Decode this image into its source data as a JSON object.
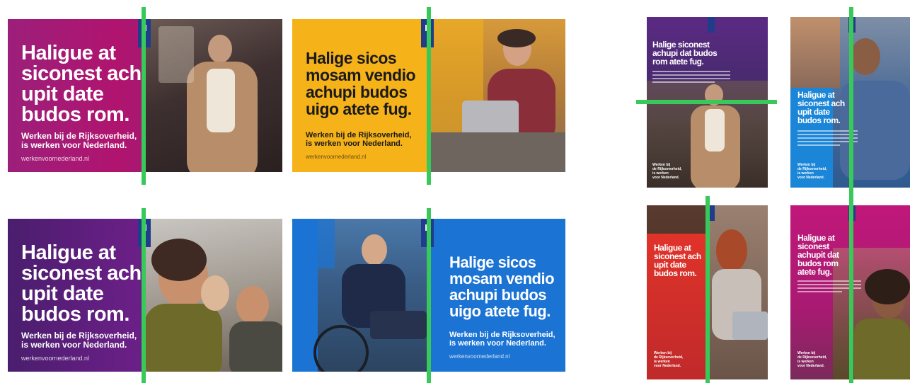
{
  "accent_color": "#38c95a",
  "cards": {
    "c1": {
      "headline": [
        "Haligue at",
        "siconest ach",
        "upit date",
        "budos rom."
      ],
      "sub": [
        "Werken bij de Rijksoverheid,",
        "is werken voor Nederland."
      ],
      "url": "werkenvoornederland.nl",
      "color": "#9c1f7a"
    },
    "c2": {
      "headline": [
        "Halige sicos",
        "mosam vendio",
        "achupi budos",
        "uigo atete fug."
      ],
      "sub": [
        "Werken bij de Rijksoverheid,",
        "is werken voor Nederland."
      ],
      "url": "werkenvoornederland.nl",
      "color": "#f6b219"
    },
    "c3": {
      "headline": [
        "Haligue at",
        "siconest ach",
        "upit date",
        "budos rom."
      ],
      "sub": [
        "Werken bij de Rijksoverheid,",
        "is werken voor Nederland."
      ],
      "url": "werkenvoornederland.nl",
      "color": "#6a1f86"
    },
    "c4": {
      "headline": [
        "Halige sicos",
        "mosam vendio",
        "achupi budos",
        "uigo atete fug."
      ],
      "sub": [
        "Werken bij de Rijksoverheid,",
        "is werken voor Nederland."
      ],
      "url": "werkenvoornederland.nl",
      "color": "#1b73d4"
    },
    "p1": {
      "headline": [
        "Halige siconest",
        "achupi dat budos",
        "rom atete fug."
      ],
      "sub": [
        "Werken bij",
        "de Rijksoverheid,",
        "is werken",
        "voor Nederland."
      ],
      "color": "#5b2a84"
    },
    "p2": {
      "headline": [
        "Haligue at",
        "siconest ach",
        "upit date",
        "budos rom."
      ],
      "sub": [
        "Werken bij",
        "de Rijksoverheid,",
        "is werken",
        "voor Nederland."
      ],
      "color": "#1b86d8"
    },
    "p3": {
      "headline": [
        "Haligue at",
        "siconest ach",
        "upit date",
        "budos rom."
      ],
      "sub": [
        "Werken bij",
        "de Rijksoverheid,",
        "is werken",
        "voor Nederland."
      ],
      "color": "#e0332a"
    },
    "p4": {
      "headline": [
        "Haligue at",
        "siconest",
        "achupit dat",
        "budos rom",
        "atete fug."
      ],
      "sub": [
        "Werken bij",
        "de Rijksoverheid,",
        "is werken",
        "voor Nederland."
      ],
      "color": "#c0187a"
    }
  }
}
